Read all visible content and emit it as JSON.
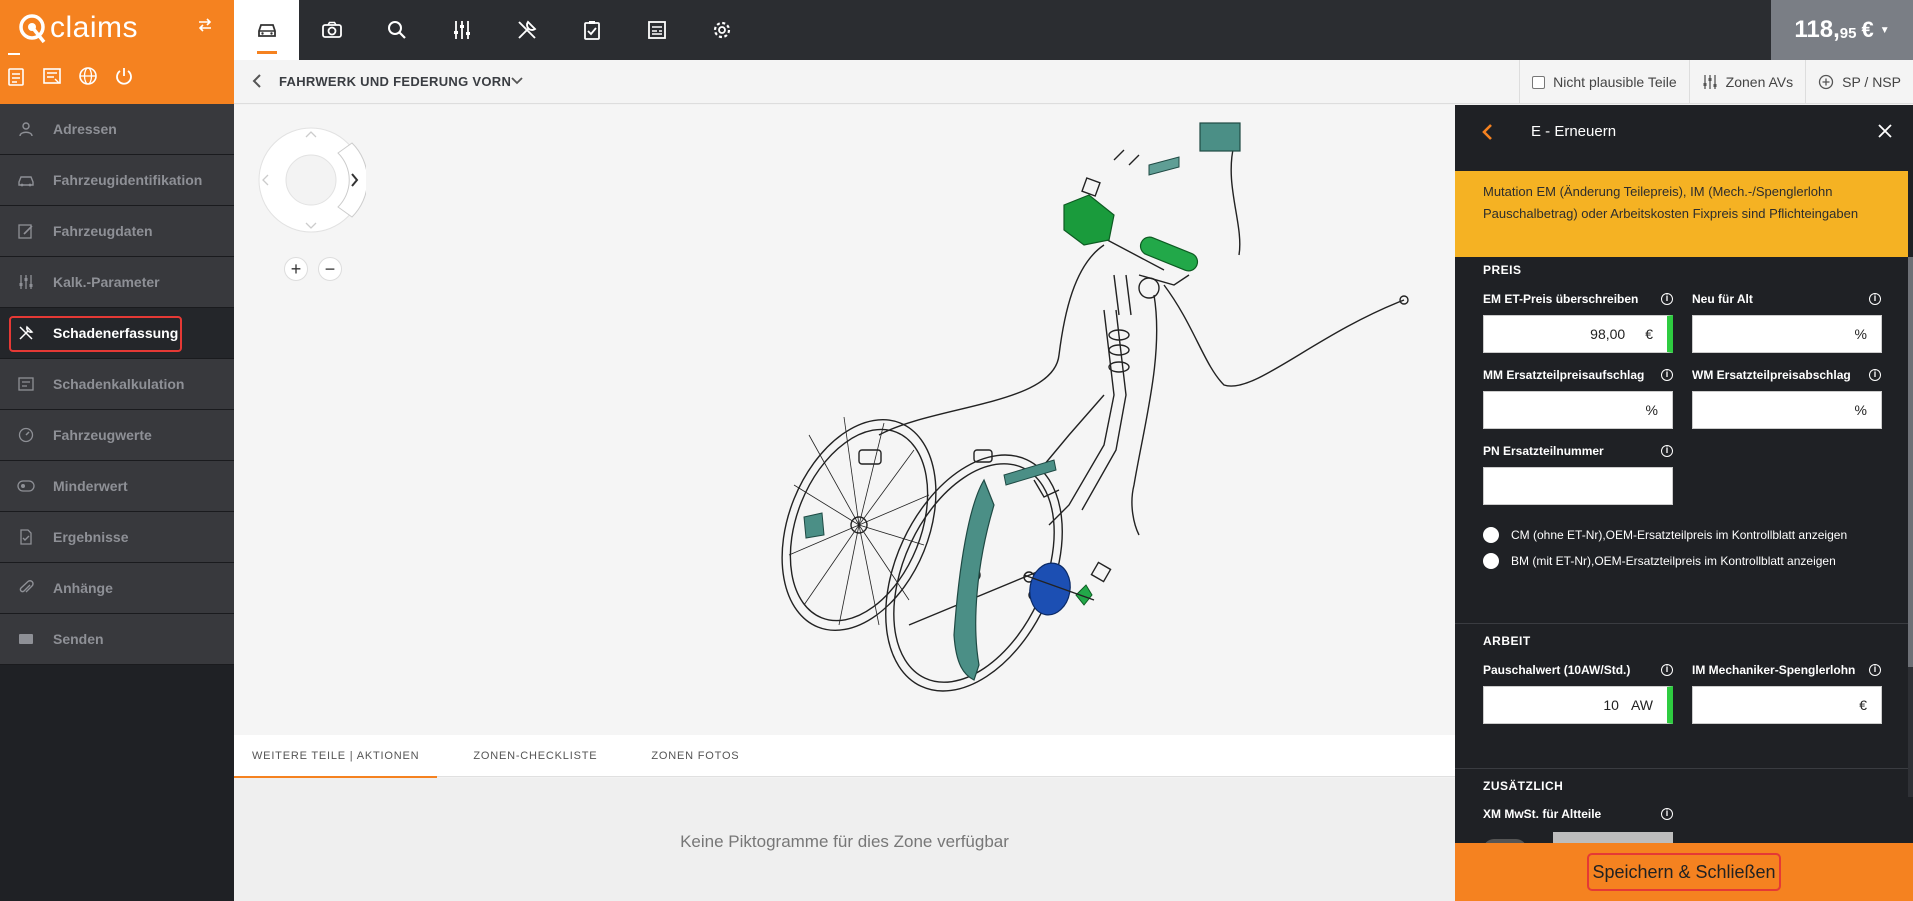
{
  "app": {
    "logo_text": "claims"
  },
  "sidebar": {
    "items": [
      {
        "label": "Adressen",
        "icon": "person-icon"
      },
      {
        "label": "Fahrzeugidentifikation",
        "icon": "car-icon"
      },
      {
        "label": "Fahrzeugdaten",
        "icon": "edit-icon"
      },
      {
        "label": "Kalk.-Parameter",
        "icon": "sliders-icon"
      },
      {
        "label": "Schadenerfassung",
        "icon": "tools-icon",
        "active": true
      },
      {
        "label": "Schadenkalkulation",
        "icon": "calc-icon"
      },
      {
        "label": "Fahrzeugwerte",
        "icon": "gauge-icon"
      },
      {
        "label": "Minderwert",
        "icon": "tag-icon"
      },
      {
        "label": "Ergebnisse",
        "icon": "doc-check-icon"
      },
      {
        "label": "Anhänge",
        "icon": "paperclip-icon"
      },
      {
        "label": "Senden",
        "icon": "send-icon"
      }
    ]
  },
  "topbar": {
    "price_main": "118,",
    "price_cents": "95",
    "price_currency": "€"
  },
  "subheader": {
    "zone_title": "FAHRWERK UND FEDERUNG VORN",
    "implausible_label": "Nicht plausible Teile",
    "zonen_avs_label": "Zonen AVs",
    "sp_nsp_label": "SP / NSP"
  },
  "tabs": [
    {
      "label": "WEITERE TEILE | AKTIONEN",
      "active": true
    },
    {
      "label": "ZONEN-CHECKLISTE"
    },
    {
      "label": "ZONEN FOTOS"
    }
  ],
  "empty_message": "Keine Piktogramme für dies Zone verfügbar",
  "panel": {
    "title": "E - Erneuern",
    "warning": "Mutation EM (Änderung Teilepreis), IM (Mech.-/Spenglerlohn Pauschalbetrag) oder Arbeitskosten Fixpreis sind Pflichteingaben",
    "preis": {
      "title": "PREIS",
      "em_label": "EM ET-Preis überschreiben",
      "em_value": "98,00",
      "em_unit": "€",
      "neu_label": "Neu für Alt",
      "neu_unit": "%",
      "mm_label": "MM Ersatzteilpreisaufschlag",
      "mm_unit": "%",
      "wm_label": "WM Ersatzteilpreisabschlag",
      "wm_unit": "%",
      "pn_label": "PN Ersatzteilnummer",
      "cm_label": "CM (ohne ET-Nr),OEM-Ersatzteilpreis im Kontrollblatt anzeigen",
      "bm_label": "BM (mit ET-Nr),OEM-Ersatzteilpreis im Kontrollblatt anzeigen"
    },
    "arbeit": {
      "title": "ARBEIT",
      "pausch_label": "Pauschalwert (10AW/Std.)",
      "pausch_value": "10",
      "pausch_unit": "AW",
      "im_label": "IM Mechaniker-Spenglerlohn",
      "im_unit": "€"
    },
    "zusatz": {
      "title": "ZUSÄTZLICH",
      "xm_label": "XM MwSt. für Altteile"
    },
    "save_label": "Speichern & Schließen"
  },
  "colors": {
    "brand": "#f58220",
    "sidebar": "#1f2125",
    "warning": "#f5b223",
    "valid": "#2ecc40",
    "highlight": "#e53935"
  }
}
